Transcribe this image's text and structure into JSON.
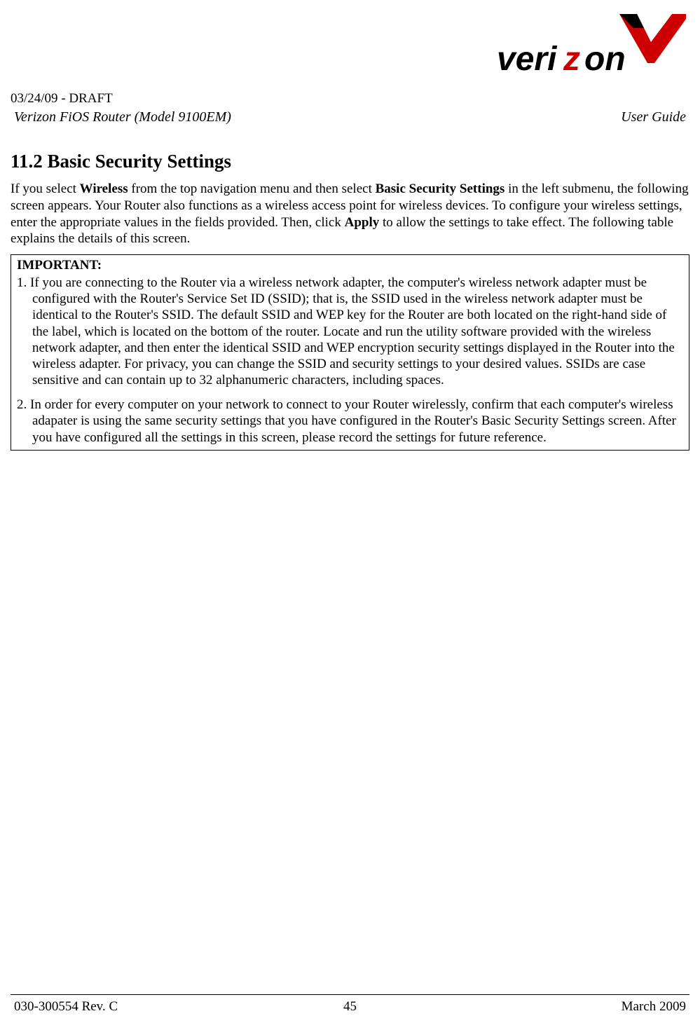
{
  "header": {
    "draft_date": "03/24/09 - DRAFT",
    "product": "Verizon FiOS Router (Model 9100EM)",
    "guide": "User Guide"
  },
  "section": {
    "number": "11.2",
    "title": "Basic Security Settings"
  },
  "paragraph": {
    "p1_pre": "If you select ",
    "p1_bold1": "Wireless",
    "p1_mid1": " from the top navigation menu and then select ",
    "p1_bold2": "Basic Security Settings",
    "p1_mid2": " in the left submenu, the following screen appears. Your Router also functions as a wireless access point for wireless devices. To configure your wireless settings, enter the appropriate values in the fields provided. Then, click ",
    "p1_bold3": "Apply",
    "p1_end": " to allow the settings to take effect. The following table explains the details of this screen."
  },
  "important": {
    "heading": "IMPORTANT:",
    "item1": "1. If you are connecting to the Router via a wireless network adapter, the computer's wireless network adapter must be configured with the Router's Service Set ID (SSID); that is, the SSID used in the wireless network adapter must be identical to the Router's SSID. The default SSID and WEP key for the Router are both located on the right-hand side of the label, which is located on the bottom of the router. Locate and run the utility software provided with the wireless network adapter, and then enter the identical SSID and WEP encryption security settings displayed in the Router into the wireless adapter. For privacy, you can change the SSID and security settings to your desired values. SSIDs are case sensitive and can contain up to 32 alphanumeric characters, including spaces.",
    "item2": "2. In order for every computer on your network to connect to your Router wirelessly, confirm that each computer's wireless adapater is using the same security settings that you have configured in the Router's Basic Security Settings screen. After you have configured all the settings in this screen, please record the settings for future reference."
  },
  "footer": {
    "left": "030-300554 Rev. C",
    "center": "45",
    "right": "March 2009"
  }
}
